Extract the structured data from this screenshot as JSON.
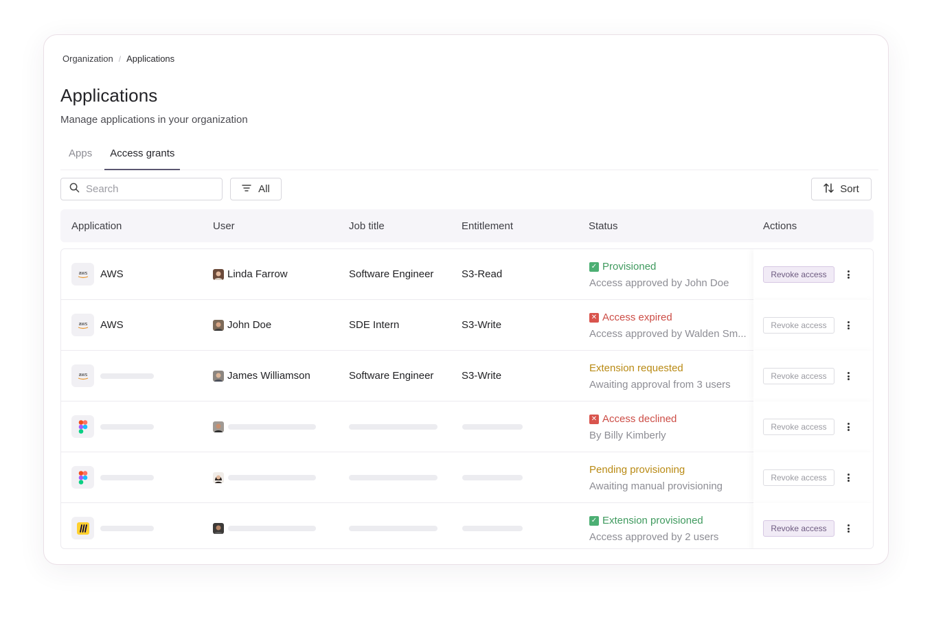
{
  "breadcrumb": {
    "root": "Organization",
    "separator": "/",
    "current": "Applications"
  },
  "page": {
    "title": "Applications",
    "subtitle": "Manage applications in your organization"
  },
  "tabs": [
    {
      "label": "Apps",
      "active": false
    },
    {
      "label": "Access grants",
      "active": true
    }
  ],
  "toolbar": {
    "search_placeholder": "Search",
    "filter_label": "All",
    "sort_label": "Sort",
    "icons": {
      "search": "search-icon",
      "filter": "filter-icon",
      "sort": "sort-arrows-icon"
    }
  },
  "table": {
    "columns": [
      "Application",
      "User",
      "Job title",
      "Entitlement",
      "Status",
      "Actions"
    ],
    "revoke_label": "Revoke access",
    "rows": [
      {
        "app_logo": "aws",
        "app": "AWS",
        "user": "Linda Farrow",
        "job": "Software Engineer",
        "entitlement": "S3-Read",
        "status": "Provisioned",
        "status_tone": "green",
        "status_icon": "check",
        "status_detail": "Access approved by John Doe",
        "revoke_highlighted": true
      },
      {
        "app_logo": "aws",
        "app": "AWS",
        "user": "John Doe",
        "job": "SDE Intern",
        "entitlement": "S3-Write",
        "status": "Access expired",
        "status_tone": "red",
        "status_icon": "x",
        "status_detail": "Access approved by Walden Sm...",
        "revoke_highlighted": false
      },
      {
        "app_logo": "aws",
        "app": "",
        "user": "James Williamson",
        "job": "Software Engineer",
        "entitlement": "S3-Write",
        "status": "Extension requested",
        "status_tone": "amber",
        "status_icon": "",
        "status_detail": "Awaiting approval from 3 users",
        "revoke_highlighted": false
      },
      {
        "app_logo": "figma",
        "app": "",
        "user": "",
        "job": "",
        "entitlement": "",
        "status": "Access declined",
        "status_tone": "red",
        "status_icon": "x",
        "status_detail": "By Billy Kimberly",
        "revoke_highlighted": false
      },
      {
        "app_logo": "figma",
        "app": "",
        "user": "",
        "job": "",
        "entitlement": "",
        "status": "Pending provisioning",
        "status_tone": "amber",
        "status_icon": "",
        "status_detail": "Awaiting manual provisioning",
        "revoke_highlighted": false
      },
      {
        "app_logo": "miro",
        "app": "",
        "user": "",
        "job": "",
        "entitlement": "",
        "status": "Extension provisioned",
        "status_tone": "green",
        "status_icon": "check",
        "status_detail": "Access approved by 2 users",
        "revoke_highlighted": true
      }
    ]
  },
  "colors": {
    "green": "#3f9a5e",
    "red": "#cc4c45",
    "amber": "#b98a14",
    "accent_bg": "#f1ebf6"
  }
}
